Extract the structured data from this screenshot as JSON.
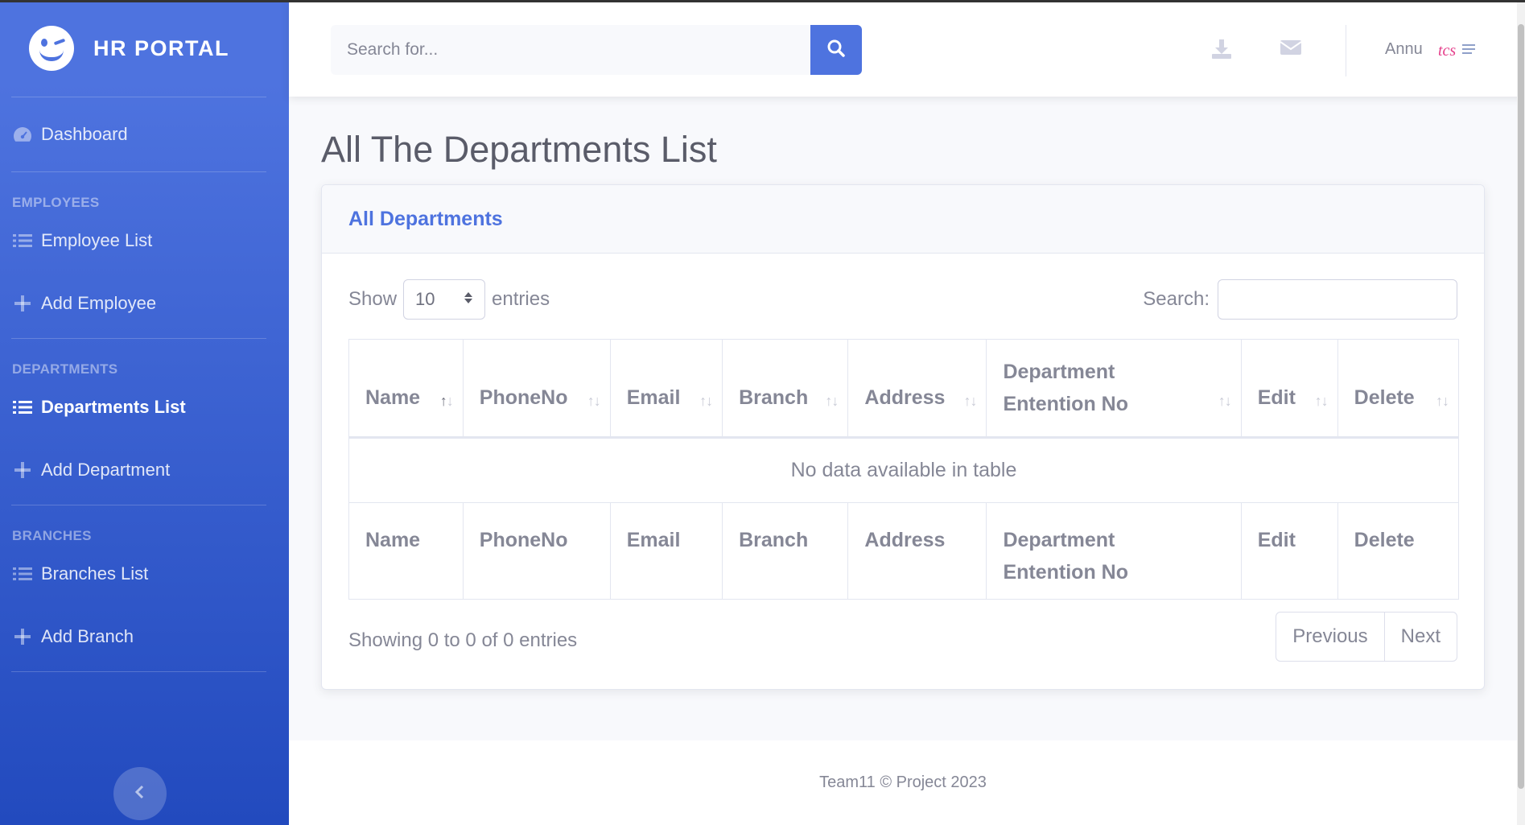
{
  "brand": {
    "title": "HR PORTAL"
  },
  "sidebar": {
    "dashboard": "Dashboard",
    "headings": {
      "employees": "EMPLOYEES",
      "departments": "DEPARTMENTS",
      "branches": "BRANCHES"
    },
    "items": {
      "employee_list": "Employee List",
      "add_employee": "Add Employee",
      "departments_list": "Departments List",
      "add_department": "Add Department",
      "branches_list": "Branches List",
      "add_branch": "Add Branch"
    }
  },
  "topbar": {
    "search_placeholder": "Search for...",
    "user_name": "Annu",
    "user_logo_text": "tcs"
  },
  "page": {
    "title": "All The Departments List"
  },
  "card": {
    "title": "All Departments",
    "show_label": "Show",
    "entries_label": "entries",
    "page_length": "10",
    "search_label": "Search:",
    "columns": [
      "Name",
      "PhoneNo",
      "Email",
      "Branch",
      "Address",
      "Department Entention No",
      "Edit",
      "Delete"
    ],
    "column_lines": {
      "department_line1": "Department",
      "department_line2": "Entention No"
    },
    "empty_message": "No data available in table",
    "info": "Showing 0 to 0 of 0 entries",
    "pagination": {
      "previous": "Previous",
      "next": "Next"
    }
  },
  "footer": {
    "text": "Team11 © Project 2023"
  },
  "colors": {
    "primary": "#4e73df",
    "sidebar_bottom": "#224abe",
    "text_muted": "#858796",
    "heading": "#5a5c69"
  }
}
